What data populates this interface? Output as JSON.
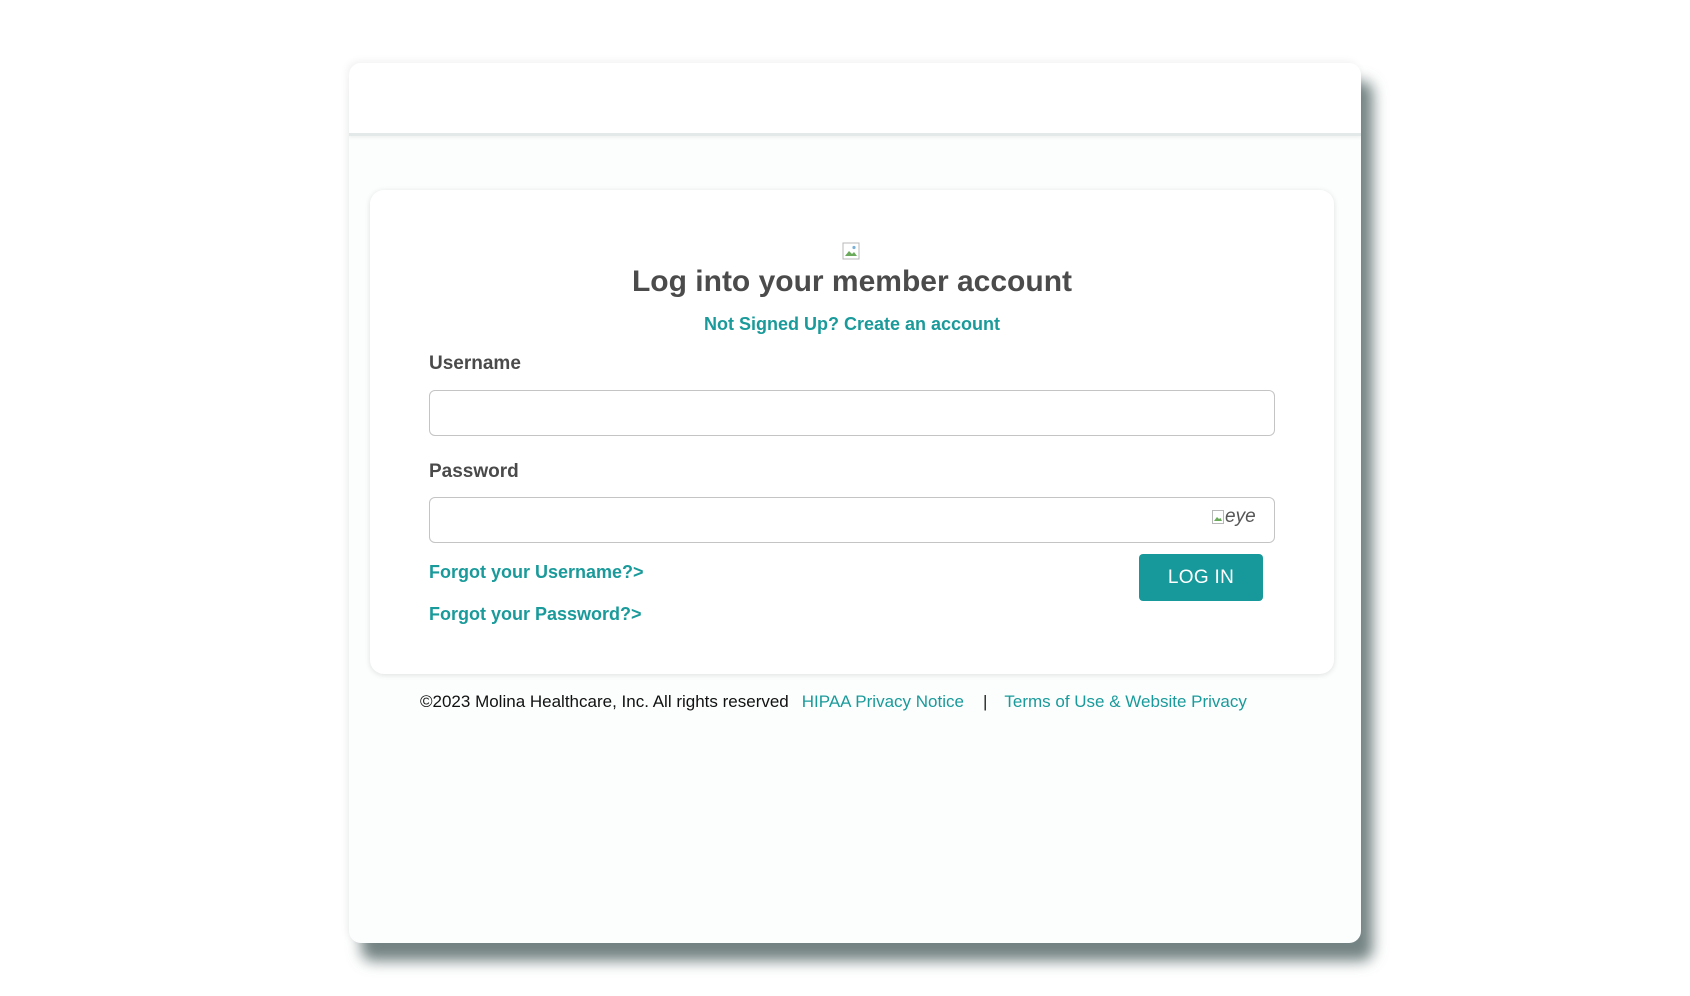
{
  "login": {
    "title": "Log into your member account",
    "signup_link": "Not Signed Up? Create an account",
    "username_label": "Username",
    "username_value": "",
    "password_label": "Password",
    "password_value": "",
    "eye_alt": "eye",
    "forgot_username": "Forgot your Username?>",
    "forgot_password": "Forgot your Password?>",
    "login_button": "LOG IN"
  },
  "footer": {
    "copyright": "©2023 Molina Healthcare, Inc. All rights reserved",
    "hipaa": "HIPAA Privacy Notice",
    "separator": "|",
    "terms": "Terms of Use & Website Privacy"
  },
  "colors": {
    "accent": "#17999b",
    "text": "#4b4b4b"
  }
}
